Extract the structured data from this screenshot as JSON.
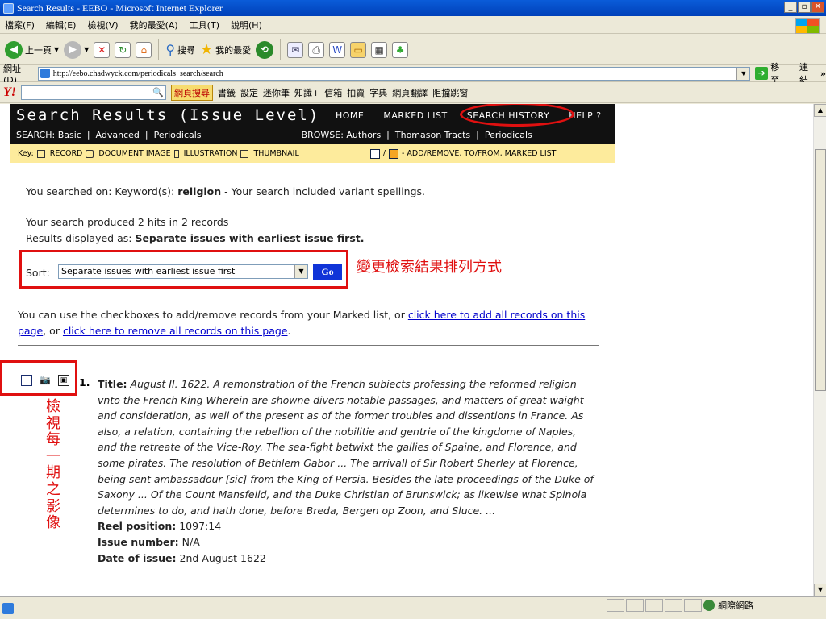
{
  "window": {
    "title": "Search Results - EEBO - Microsoft Internet Explorer",
    "buttons": [
      "_",
      "▫",
      "✕"
    ]
  },
  "menu": [
    "檔案(F)",
    "編輯(E)",
    "檢視(V)",
    "我的最愛(A)",
    "工具(T)",
    "說明(H)"
  ],
  "toolbar": {
    "back": "上一頁",
    "search": "搜尋",
    "favorites": "我的最愛"
  },
  "address": {
    "label": "網址(D)",
    "url": "http://eebo.chadwyck.com/periodicals_search/search",
    "go": "移至",
    "links": "連結"
  },
  "yahoo_bar": {
    "search_btn": "網頁搜尋",
    "items": [
      "書籤",
      "設定",
      "迷你筆",
      "知識+",
      "信箱",
      "拍賣",
      "字典",
      "網頁翻譯",
      "阻擋跳窗"
    ]
  },
  "page": {
    "title": "Search Results (Issue Level)",
    "nav": [
      "HOME",
      "MARKED LIST",
      "SEARCH HISTORY",
      "HELP ?"
    ],
    "search_label": "SEARCH:",
    "search_links": [
      "Basic",
      "Advanced",
      "Periodicals"
    ],
    "browse_label": "BROWSE:",
    "browse_links": [
      "Authors",
      "Thomason Tracts",
      "Periodicals"
    ],
    "key_label": "Key:",
    "key_items": [
      "RECORD",
      "DOCUMENT IMAGE",
      "ILLUSTRATION",
      "THUMBNAIL"
    ],
    "key_marked": "/ ",
    "key_marked_text": "- ADD/REMOVE, TO/FROM, MARKED LIST",
    "searched_on_prefix": "You searched on: Keyword(s): ",
    "searched_term": "religion",
    "searched_suffix": " - Your search included variant spellings.",
    "hits": "Your search produced 2 hits in 2 records",
    "displayed_prefix": "Results displayed as: ",
    "displayed_value": "Separate issues with earliest issue first.",
    "sort_label": "Sort:",
    "sort_value": "Separate issues with earliest issue first",
    "go_label": "Go",
    "annotation_sort": "變更檢索結果排列方式",
    "checkbox_intro": "You can use the checkboxes to add/remove records from your Marked list, or ",
    "add_all_link": "click here to add all records on this page",
    "or_text": ", or ",
    "remove_all_link": "click here to remove all records on this page",
    "period": ".",
    "annotation_view": "檢視每一期之影像"
  },
  "record": {
    "number": "1.",
    "title_label": "Title:",
    "title_text": "August II. 1622. A remonstration of the French subiects professing the reformed religion vnto the French King Wherein are showne divers notable passages, and matters of great waight and consideration, as well of the present as of the former troubles and dissentions in France. As also, a relation, containing the rebellion of the nobilitie and gentrie of the kingdome of Naples, and the retreate of the Vice-Roy. The sea-fight betwixt the gallies of Spaine, and Florence, and some pirates. The resolution of Bethlem Gabor ... The arrivall of Sir Robert Sherley at Florence, being sent ambassadour [sic] from the King of Persia. Besides the late proceedings of the Duke of Saxony ... Of the Count Mansfeild, and the Duke Christian of Brunswick; as likewise what Spinola determines to do, and hath done, before Breda, Bergen op Zoon, and Sluce. ...",
    "reel_label": "Reel position:",
    "reel_value": "1097:14",
    "issue_label": "Issue number:",
    "issue_value": "N/A",
    "date_label": "Date of issue:",
    "date_value": "2nd August 1622"
  },
  "status": {
    "zone": "網際網路"
  }
}
